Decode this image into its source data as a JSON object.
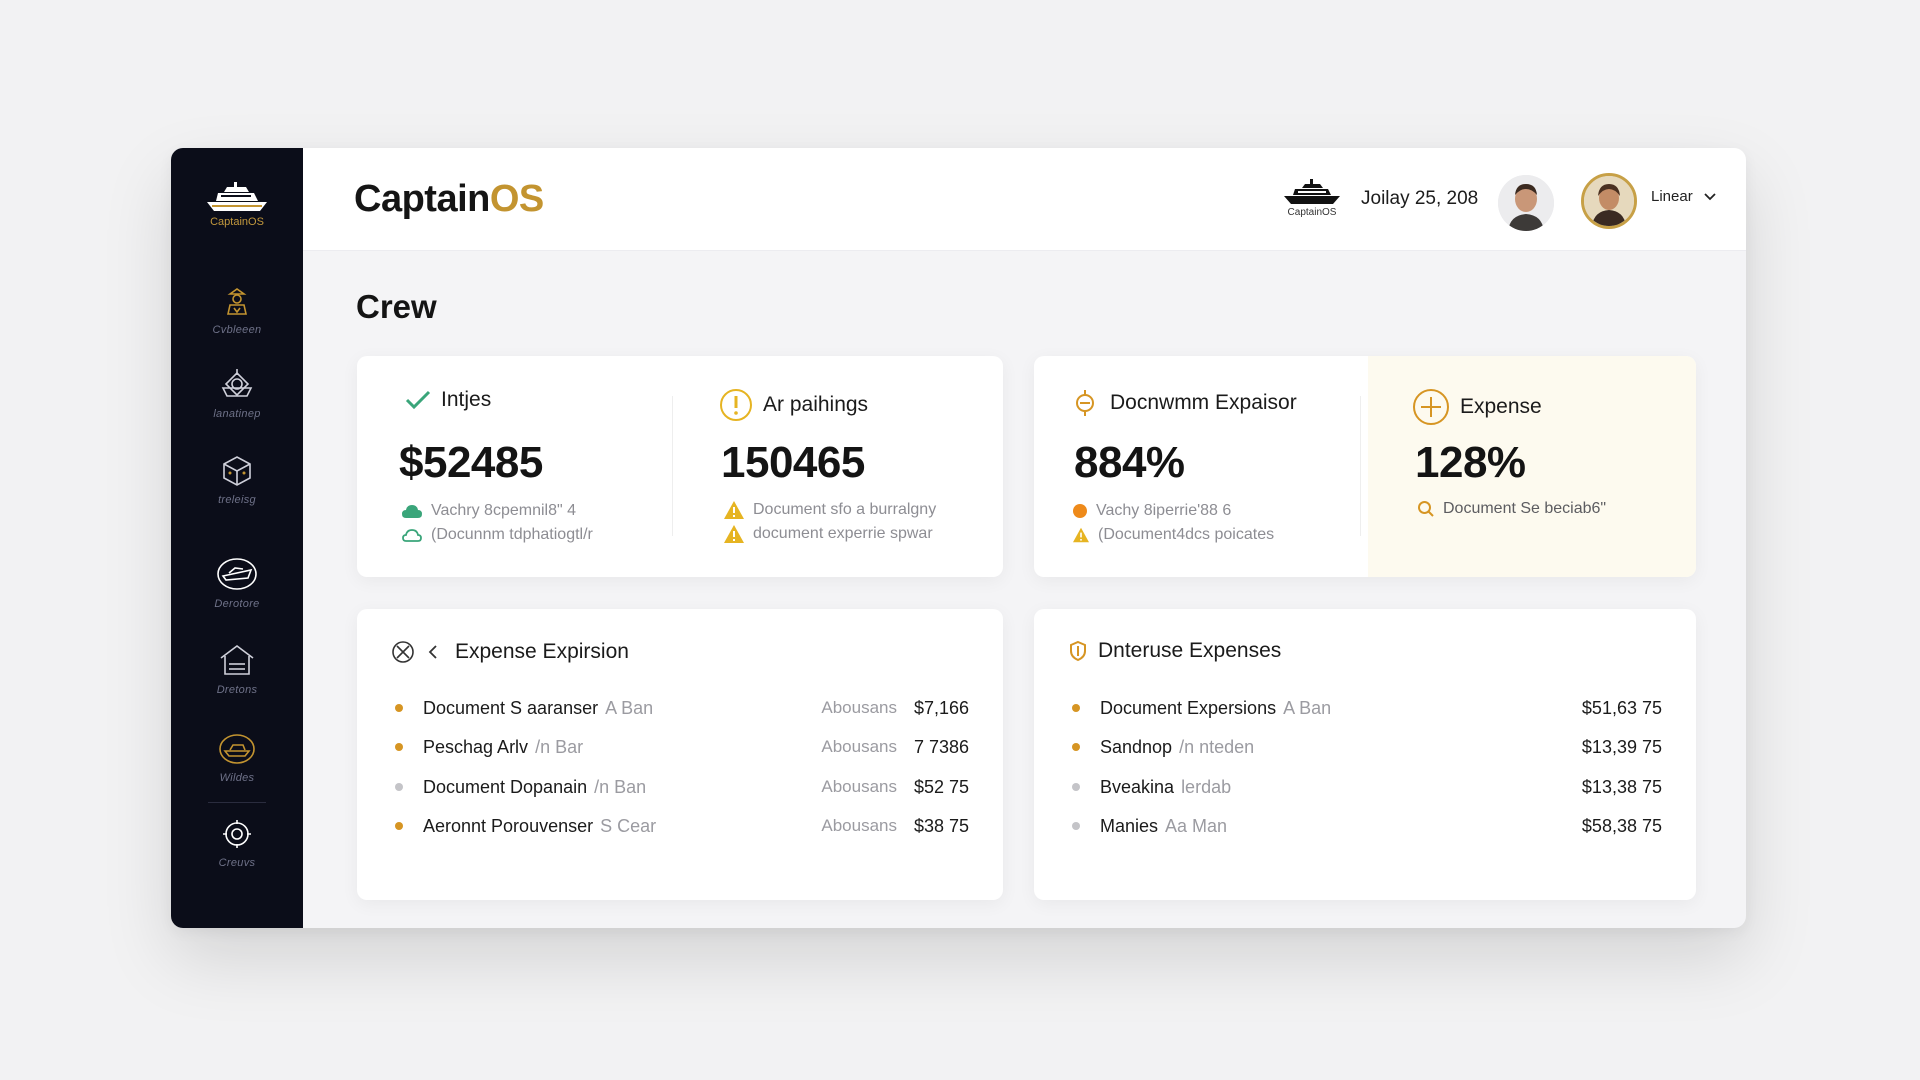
{
  "app": {
    "brand_part1": "Captain",
    "brand_part2": "OS",
    "brand_color": "#c39430",
    "sidebar_logo_text": "CaptainOS",
    "header_logo_text": "CaptainOS",
    "date": "Joilay 25, 208",
    "user_name": "Linear"
  },
  "sidebar": {
    "items": [
      {
        "label": "Cvbleeen",
        "icon": "captain-figure-icon"
      },
      {
        "label": "lanatinep",
        "icon": "ship-helm-icon"
      },
      {
        "label": "treleisg",
        "icon": "cargo-crate-icon"
      },
      {
        "label": "Derotore",
        "icon": "speedboat-icon"
      },
      {
        "label": "Dretons",
        "icon": "harbor-house-icon"
      },
      {
        "label": "Wildes",
        "icon": "yacht-icon"
      },
      {
        "label": "Creuvs",
        "icon": "lifebuoy-icon"
      }
    ]
  },
  "page": {
    "title": "Crew"
  },
  "stats": [
    {
      "title": "Intjes",
      "icon": "check-icon",
      "value": "$52485",
      "sub1": "Vachry 8cpemnil8\" 4",
      "sub2": "(Docunnm tdphatiogtl/r"
    },
    {
      "title": "Ar paihings",
      "icon": "alert-circle-icon",
      "value": "150465",
      "sub1": "Document sfo a burralgny",
      "sub2": "document experrie spwar"
    },
    {
      "title": "Docnwmm Expaisor",
      "icon": "document-expiry-icon",
      "value": "884%",
      "sub1": "Vachy 8iperrie'88 6",
      "sub2": "(Document4dcs poicates"
    },
    {
      "title": "Expense",
      "icon": "plus-circle-icon",
      "value": "128%",
      "sub1": "Document Se beciab6\""
    }
  ],
  "expense_expirsion": {
    "title": "Expense Expirsion",
    "rows": [
      {
        "name": "Document S aaranser",
        "tag": "A Ban",
        "who": "Abousans",
        "amount": "$7,166",
        "status": "gold"
      },
      {
        "name": "Peschag Arlv",
        "tag": "/n Bar",
        "who": "Abousans",
        "amount": "7 7386",
        "status": "gold"
      },
      {
        "name": "Document Dopanain",
        "tag": "/n Ban",
        "who": "Abousans",
        "amount": "$52 75",
        "status": "grey"
      },
      {
        "name": "Aeronnt Porouvenser",
        "tag": "S Cear",
        "who": "Abousans",
        "amount": "$38 75",
        "status": "gold"
      }
    ]
  },
  "dnteruse_expenses": {
    "title": "Dnteruse Expenses",
    "rows": [
      {
        "name": "Document Expersions",
        "tag": "A Ban",
        "amount": "$51,63 75",
        "status": "gold"
      },
      {
        "name": "Sandnop",
        "tag": "/n nteden",
        "amount": "$13,39 75",
        "status": "gold"
      },
      {
        "name": "Bveakina",
        "tag": "lerdab",
        "amount": "$13,38 75",
        "status": "grey"
      },
      {
        "name": "Manies",
        "tag": "Aa Man",
        "amount": "$58,38 75",
        "status": "grey"
      }
    ]
  },
  "colors": {
    "sidebar_bg": "#0b0d19",
    "accent_gold": "#c39430",
    "check_green": "#3aa57a",
    "warning_yellow": "#e6b422",
    "alert_orange": "#ee8a1a"
  }
}
